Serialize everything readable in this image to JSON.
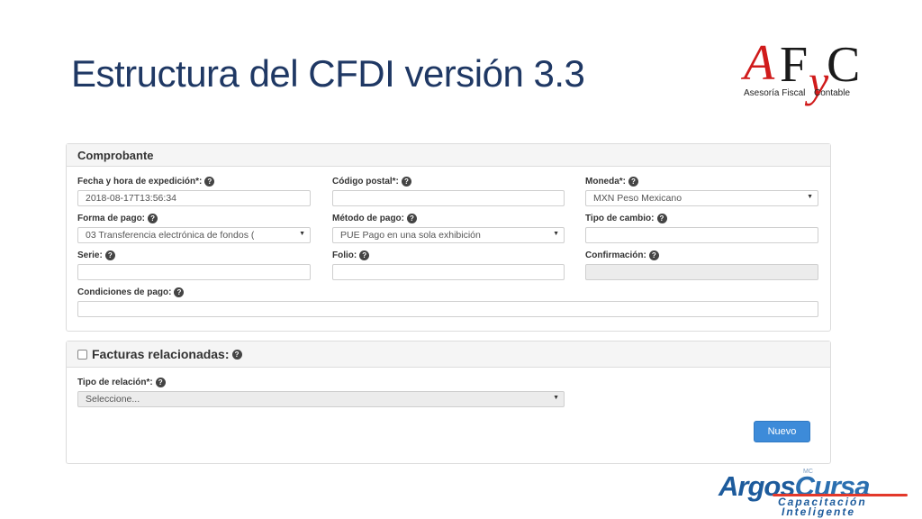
{
  "slide": {
    "title": "Estructura del CFDI versión 3.3"
  },
  "logo_afyc": {
    "letters": [
      "A",
      "F",
      "y",
      "C"
    ],
    "subtitle_left": "Asesoría Fiscal",
    "subtitle_right": "Contable"
  },
  "comprobante": {
    "title": "Comprobante",
    "fields": {
      "fecha": {
        "label": "Fecha y hora de expedición*:",
        "value": "2018-08-17T13:56:34"
      },
      "codigo_postal": {
        "label": "Código postal*:",
        "value": ""
      },
      "moneda": {
        "label": "Moneda*:",
        "value": "MXN Peso Mexicano"
      },
      "forma_pago": {
        "label": "Forma de pago:",
        "value": "03 Transferencia electrónica de fondos ("
      },
      "metodo_pago": {
        "label": "Método de pago:",
        "value": "PUE Pago en una sola exhibición"
      },
      "tipo_cambio": {
        "label": "Tipo de cambio:",
        "value": ""
      },
      "serie": {
        "label": "Serie:",
        "value": ""
      },
      "folio": {
        "label": "Folio:",
        "value": ""
      },
      "confirmacion": {
        "label": "Confirmación:",
        "value": ""
      },
      "condiciones_pago": {
        "label": "Condiciones de pago:",
        "value": ""
      }
    }
  },
  "facturas": {
    "title": "Facturas relacionadas:",
    "tipo_relacion": {
      "label": "Tipo de relación*:",
      "value": "Seleccione..."
    },
    "nuevo_label": "Nuevo"
  },
  "logo_argos": {
    "word_left": "Argos",
    "word_right": "Cursa",
    "mark": "MC",
    "line1": "Capacitación",
    "line2": "Inteligente"
  },
  "icons": {
    "help": "question-circle-icon"
  },
  "colors": {
    "title": "#1f3864",
    "accent_red": "#d01b1b",
    "button": "#3d8bd9",
    "brand_blue": "#1d5b9c"
  }
}
